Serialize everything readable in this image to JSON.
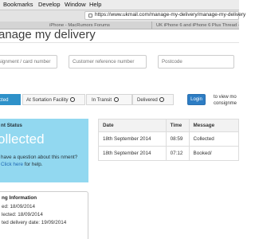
{
  "menubar": {
    "items": [
      "Bookmarks",
      "Develop",
      "Window",
      "Help"
    ]
  },
  "browser": {
    "url": "https://www.ukmail.com/manage-my-delivery/manage-my-delivery",
    "tabs": [
      "iPhone - MacRumors Forums",
      "UK iPhone 6 and iPhone 6 Plus Thread - P"
    ]
  },
  "page": {
    "title": "anage my delivery"
  },
  "search": {
    "tracking_placeholder": "nsignment / card number",
    "reference_placeholder": "Customer reference number",
    "postcode_placeholder": "Postcode"
  },
  "steps": [
    {
      "label": "cted",
      "state": "active"
    },
    {
      "label": "At Sortation Facility",
      "state": "pending"
    },
    {
      "label": "In Transit",
      "state": "pending"
    },
    {
      "label": "Delivered",
      "state": "pending"
    }
  ],
  "login": {
    "button_label": "Login",
    "hint_line1": "to view mo",
    "hint_line2": "consignme"
  },
  "status": {
    "heading": "nt Status",
    "value": "ollected",
    "help_text": "have a question about this nment? ",
    "help_link": "Click here",
    "help_suffix": " for help."
  },
  "tracking_info": {
    "heading": "ng Information",
    "line1": "ed: 18/09/2014",
    "line2": "lected: 18/09/2014",
    "line3": "ted delivery date: 19/09/2014"
  },
  "events_table": {
    "columns": [
      "Date",
      "Time",
      "Message"
    ],
    "rows": [
      [
        "18th September 2014",
        "08:59",
        "Collected"
      ],
      [
        "18th September 2014",
        "07:12",
        "Booked/"
      ]
    ]
  },
  "colors": {
    "accent": "#2e91c9",
    "status_panel": "#92d8f0",
    "login_button": "#2d7dc4"
  }
}
